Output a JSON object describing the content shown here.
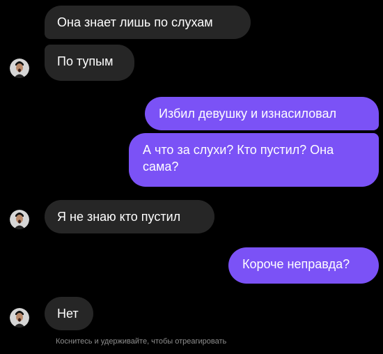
{
  "colors": {
    "background": "#000000",
    "incoming_bubble": "#262626",
    "outgoing_bubble": "#7b52f6",
    "hint_text": "#8e8e8e"
  },
  "messages": [
    {
      "side": "in",
      "text": "Она знает лишь по слухам"
    },
    {
      "side": "in",
      "text": "По тупым"
    },
    {
      "side": "out",
      "text": "Избил девушку и изнасиловал"
    },
    {
      "side": "out",
      "text": "А что за слухи? Кто пустил? Она сама?"
    },
    {
      "side": "in",
      "text": "Я не знаю кто пустил"
    },
    {
      "side": "out",
      "text": "Короче неправда?"
    },
    {
      "side": "in",
      "text": "Нет"
    }
  ],
  "avatar_icon": "user-avatar-icon",
  "hint": "Коснитесь и удерживайте, чтобы отреагировать"
}
